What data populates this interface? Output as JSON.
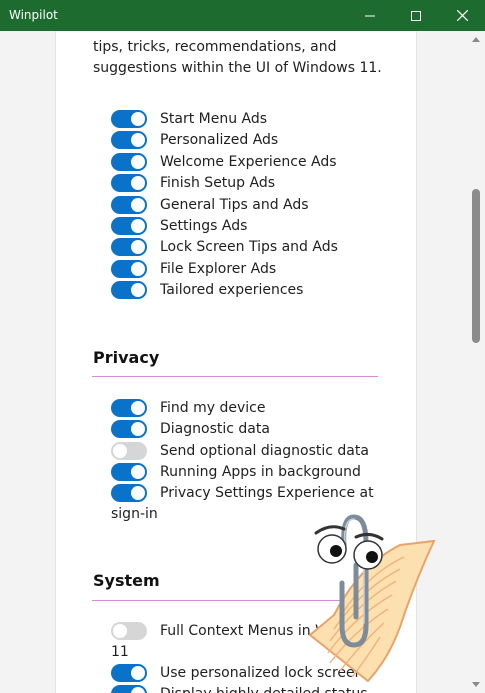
{
  "app": {
    "title": "Winpilot"
  },
  "intro": {
    "line1": "tips, tricks, recommendations, and",
    "line2": "suggestions within the UI of Windows 11."
  },
  "ads_toggles": [
    {
      "label": "Start Menu Ads",
      "on": true
    },
    {
      "label": "Personalized Ads",
      "on": true
    },
    {
      "label": "Welcome Experience Ads",
      "on": true
    },
    {
      "label": "Finish Setup Ads",
      "on": true
    },
    {
      "label": "General Tips and Ads",
      "on": true
    },
    {
      "label": "Settings Ads",
      "on": true
    },
    {
      "label": "Lock Screen Tips and Ads",
      "on": true
    },
    {
      "label": "File Explorer Ads",
      "on": true
    },
    {
      "label": "Tailored experiences",
      "on": true
    }
  ],
  "privacy": {
    "title": "Privacy",
    "toggles": [
      {
        "label": "Find my device",
        "on": true
      },
      {
        "label": "Diagnostic data",
        "on": true
      },
      {
        "label": "Send optional diagnostic data",
        "on": false
      },
      {
        "label": "Running Apps in background",
        "on": true
      },
      {
        "label": "Privacy Settings Experience at",
        "on": true
      }
    ],
    "wrap_text": "sign-in"
  },
  "system": {
    "title": "System",
    "toggles": [
      {
        "label": "Full Context Menus in W",
        "on": false
      },
      {
        "label": "Use personalized lock screen",
        "on": true
      },
      {
        "label": "Display highly detailed status",
        "on": true
      }
    ],
    "wrap_text": "11"
  },
  "colors": {
    "titlebar": "#1e6b30",
    "toggle_on": "#0a72c9",
    "toggle_off": "#d6d6d6",
    "section_rule": "#d98bd9"
  },
  "icons": {
    "minimize": "minimize-icon",
    "maximize": "maximize-icon",
    "close": "close-icon",
    "assistant": "clippy-icon"
  }
}
